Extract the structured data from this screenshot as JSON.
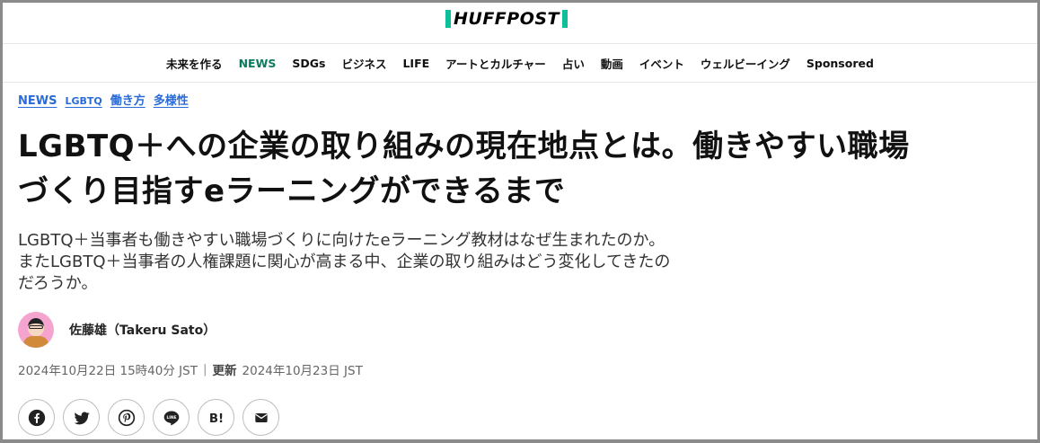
{
  "site": {
    "logo_text": "HUFFPOST"
  },
  "nav": {
    "items": [
      "未来を作る",
      "NEWS",
      "SDGs",
      "ビジネス",
      "LIFE",
      "アートとカルチャー",
      "占い",
      "動画",
      "イベント",
      "ウェルビーイング",
      "Sponsored"
    ],
    "active": "NEWS"
  },
  "article": {
    "tags": [
      "NEWS",
      "LGBTQ",
      "働き方",
      "多様性"
    ],
    "headline": "LGBTQ＋への企業の取り組みの現在地点とは。働きやすい職場づくり目指すeラーニングができるまで",
    "dek": "LGBTQ＋当事者も働きやすい職場づくりに向けたeラーニング教材はなぜ生まれたのか。またLGBTQ＋当事者の人権課題に関心が高まる中、企業の取り組みはどう変化してきたのだろうか。",
    "author": "佐藤雄（Takeru Sato）",
    "published": "2024年10月22日 15時40分 JST",
    "separator": "|",
    "updated_label": "更新",
    "updated": "2024年10月23日 JST"
  },
  "share_buttons": [
    "facebook-icon",
    "twitter-icon",
    "pinterest-icon",
    "line-icon",
    "hatena-bookmark-icon",
    "email-icon"
  ],
  "colors": {
    "accent": "#0dbe98",
    "nav_active": "#0c7a5f",
    "tag_link": "#2a6bd6"
  }
}
